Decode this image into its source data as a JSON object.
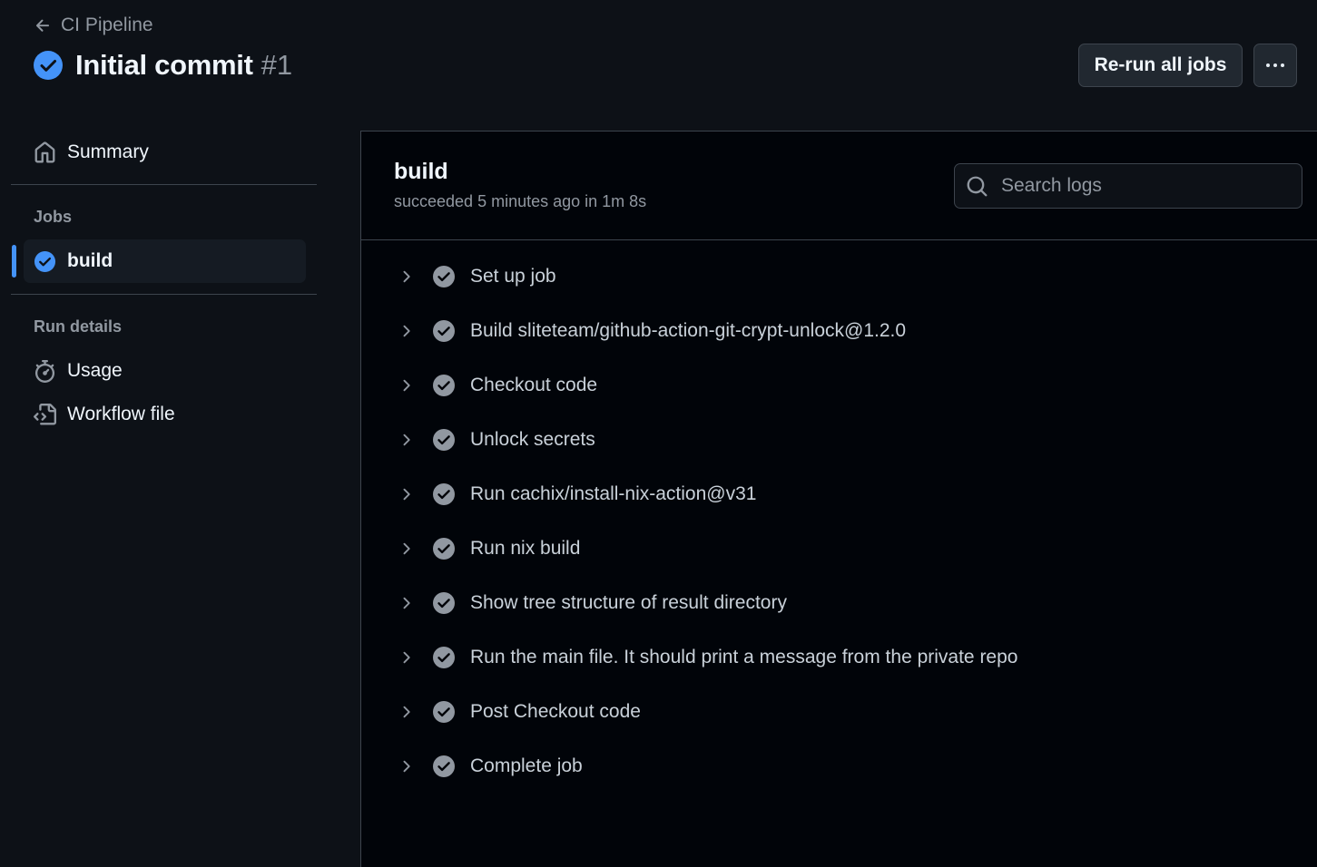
{
  "header": {
    "back_label": "CI Pipeline",
    "run_title": "Initial commit",
    "run_number": "#1",
    "rerun_label": "Re-run all jobs"
  },
  "sidebar": {
    "summary_label": "Summary",
    "jobs_heading": "Jobs",
    "jobs": [
      {
        "label": "build",
        "status": "success"
      }
    ],
    "run_details_heading": "Run details",
    "run_details": [
      {
        "label": "Usage",
        "icon": "stopwatch-icon"
      },
      {
        "label": "Workflow file",
        "icon": "file-code-icon"
      }
    ]
  },
  "job": {
    "title": "build",
    "meta": "succeeded 5 minutes ago in 1m 8s",
    "search_placeholder": "Search logs",
    "steps": [
      {
        "label": "Set up job",
        "status": "success"
      },
      {
        "label": "Build sliteteam/github-action-git-crypt-unlock@1.2.0",
        "status": "success"
      },
      {
        "label": "Checkout code",
        "status": "success"
      },
      {
        "label": "Unlock secrets",
        "status": "success"
      },
      {
        "label": "Run cachix/install-nix-action@v31",
        "status": "success"
      },
      {
        "label": "Run nix build",
        "status": "success"
      },
      {
        "label": "Show tree structure of result directory",
        "status": "success"
      },
      {
        "label": "Run the main file. It should print a message from the private repo",
        "status": "success"
      },
      {
        "label": "Post Checkout code",
        "status": "success"
      },
      {
        "label": "Complete job",
        "status": "success"
      }
    ]
  },
  "colors": {
    "background": "#0d1117",
    "panel": "#010409",
    "accent": "#4493f8",
    "success_icon": "#9198a1",
    "border": "#3d444d"
  }
}
